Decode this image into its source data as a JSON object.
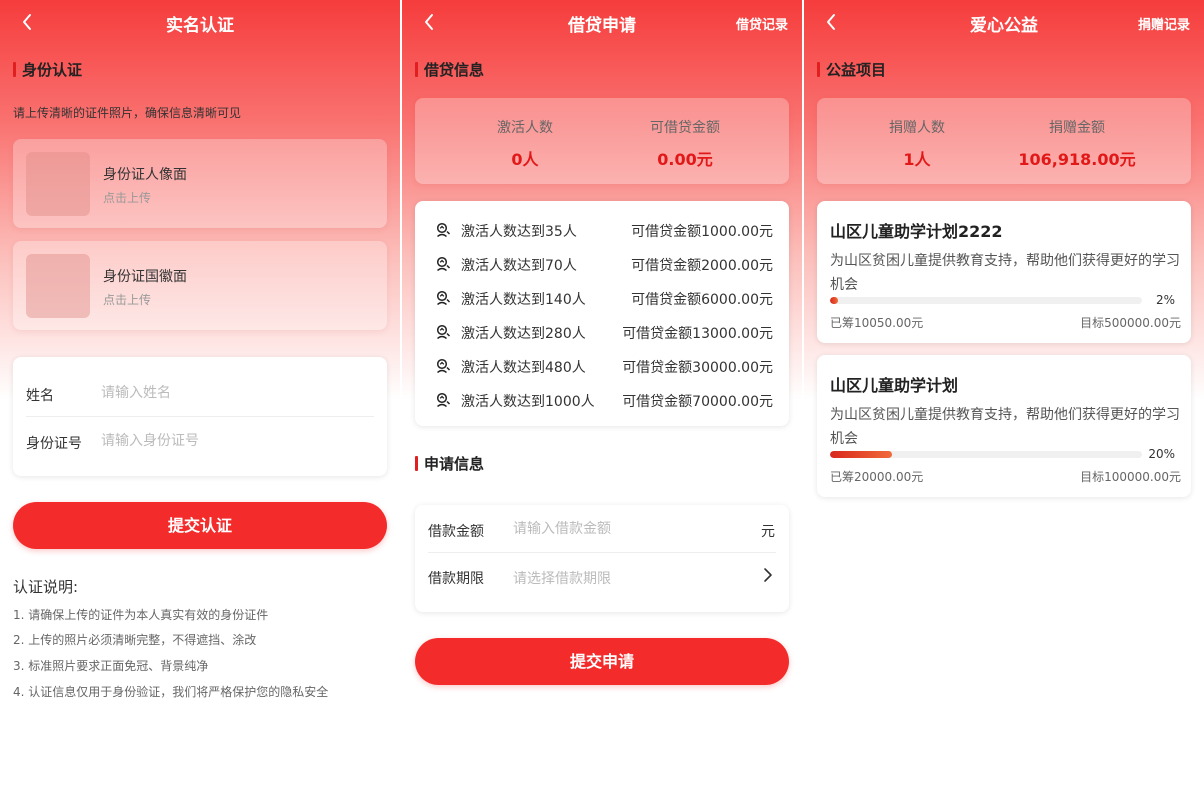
{
  "screens": {
    "verify": {
      "title": "实名认证",
      "section_title": "身份认证",
      "hint": "请上传清晰的证件照片，确保信息清晰可见",
      "uploads": [
        {
          "title": "身份证人像面",
          "sub": "点击上传"
        },
        {
          "title": "身份证国徽面",
          "sub": "点击上传"
        }
      ],
      "form": {
        "name_label": "姓名",
        "name_placeholder": "请输入姓名",
        "id_label": "身份证号",
        "id_placeholder": "请输入身份证号"
      },
      "submit_label": "提交认证",
      "notes_title": "认证说明:",
      "notes": [
        "1. 请确保上传的证件为本人真实有效的身份证件",
        "2. 上传的照片必须清晰完整，不得遮挡、涂改",
        "3. 标准照片要求正面免冠、背景纯净",
        "4. 认证信息仅用于身份验证，我们将严格保护您的隐私安全"
      ]
    },
    "loan": {
      "title": "借贷申请",
      "right_link": "借贷记录",
      "section_title": "借贷信息",
      "stats": [
        {
          "label": "激活人数",
          "value": "0人"
        },
        {
          "label": "可借贷金额",
          "value": "0.00元"
        }
      ],
      "tiers": [
        {
          "left": "激活人数达到35人",
          "right": "可借贷金额1000.00元"
        },
        {
          "left": "激活人数达到70人",
          "right": "可借贷金额2000.00元"
        },
        {
          "left": "激活人数达到140人",
          "right": "可借贷金额6000.00元"
        },
        {
          "left": "激活人数达到280人",
          "right": "可借贷金额13000.00元"
        },
        {
          "left": "激活人数达到480人",
          "right": "可借贷金额30000.00元"
        },
        {
          "left": "激活人数达到1000人",
          "right": "可借贷金额70000.00元"
        }
      ],
      "tier_icon": "user-badge-icon",
      "apply_title": "申请信息",
      "form": {
        "amount_label": "借款金额",
        "amount_placeholder": "请输入借款金额",
        "amount_unit": "元",
        "term_label": "借款期限",
        "term_placeholder": "请选择借款期限"
      },
      "submit_label": "提交申请"
    },
    "charity": {
      "title": "爱心公益",
      "right_link": "捐赠记录",
      "section_title": "公益项目",
      "stats": [
        {
          "label": "捐赠人数",
          "value": "1人"
        },
        {
          "label": "捐赠金额",
          "value": "106,918.00元"
        }
      ],
      "projects": [
        {
          "title": "山区儿童助学计划2222",
          "desc": "为山区贫困儿童提供教育支持，帮助他们获得更好的学习机会",
          "progress": 0.02,
          "percent": "2%",
          "raised": "已筹10050.00元",
          "target": "目标500000.00元"
        },
        {
          "title": "山区儿童助学计划",
          "desc": "为山区贫困儿童提供教育支持，帮助他们获得更好的学习机会",
          "progress": 0.2,
          "percent": "20%",
          "raised": "已筹20000.00元",
          "target": "目标100000.00元"
        }
      ]
    }
  },
  "colors": {
    "primary": "#f42b2b",
    "accent_text": "#e21818",
    "header_top": "#f63c3c"
  }
}
